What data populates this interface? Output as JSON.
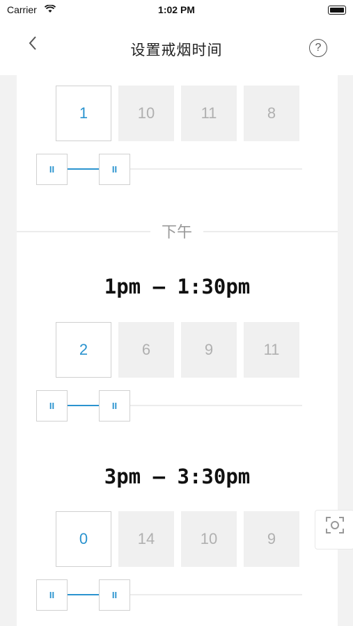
{
  "status": {
    "carrier": "Carrier",
    "time": "1:02 PM"
  },
  "nav": {
    "title": "设置戒烟时间",
    "back_icon": "chevron-left-icon",
    "help_icon": "help-circle-icon"
  },
  "section_label": "下午",
  "blocks": [
    {
      "time": "",
      "values": [
        "1",
        "10",
        "11",
        "8"
      ]
    },
    {
      "time": "1pm – 1:30pm",
      "values": [
        "2",
        "6",
        "9",
        "11"
      ]
    },
    {
      "time": "3pm – 3:30pm",
      "values": [
        "0",
        "14",
        "10",
        "9"
      ]
    }
  ],
  "slider": {
    "knob_glyph": "II"
  },
  "colors": {
    "accent": "#2a93cf",
    "cell_bg": "#f0f0f0",
    "page_bg": "#f2f2f2"
  }
}
